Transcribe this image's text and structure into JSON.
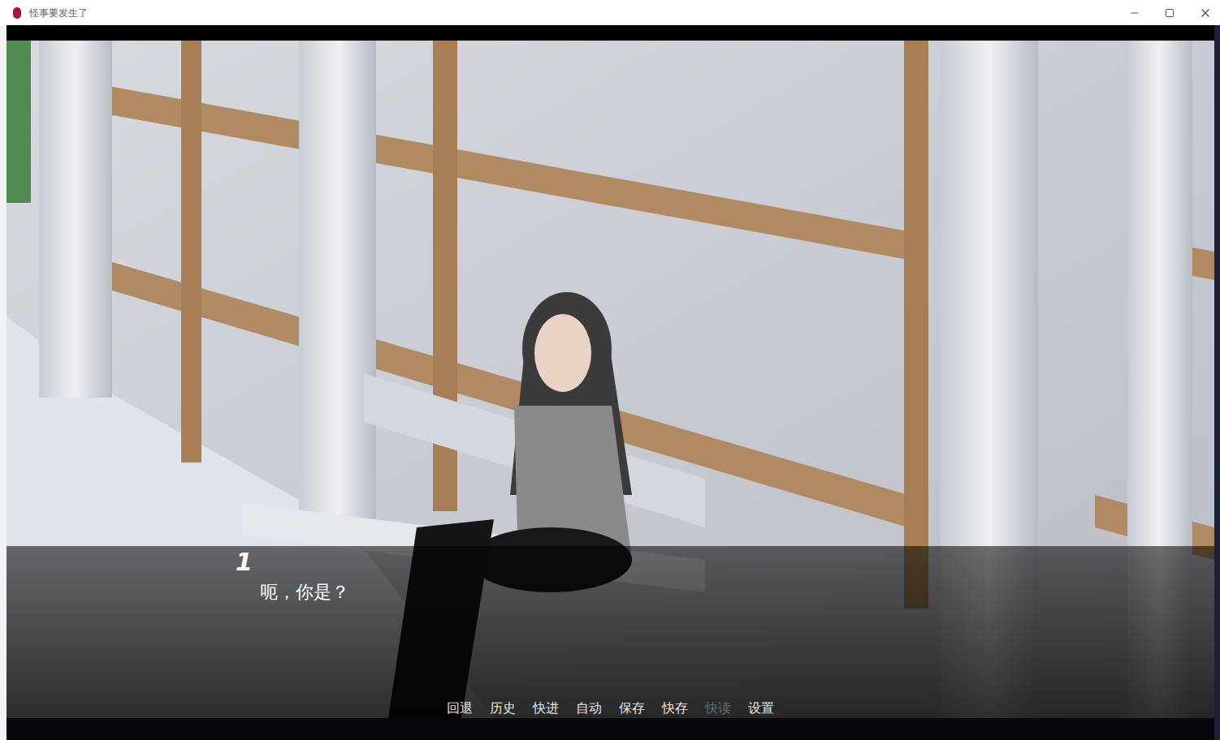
{
  "window": {
    "title": "怪事要发生了"
  },
  "dialogue": {
    "speaker": "1",
    "text": "呃，你是？"
  },
  "quick_menu": [
    {
      "label": "回退",
      "disabled": false
    },
    {
      "label": "历史",
      "disabled": false
    },
    {
      "label": "快进",
      "disabled": false
    },
    {
      "label": "自动",
      "disabled": false
    },
    {
      "label": "保存",
      "disabled": false
    },
    {
      "label": "快存",
      "disabled": false
    },
    {
      "label": "快读",
      "disabled": true
    },
    {
      "label": "设置",
      "disabled": false
    }
  ]
}
